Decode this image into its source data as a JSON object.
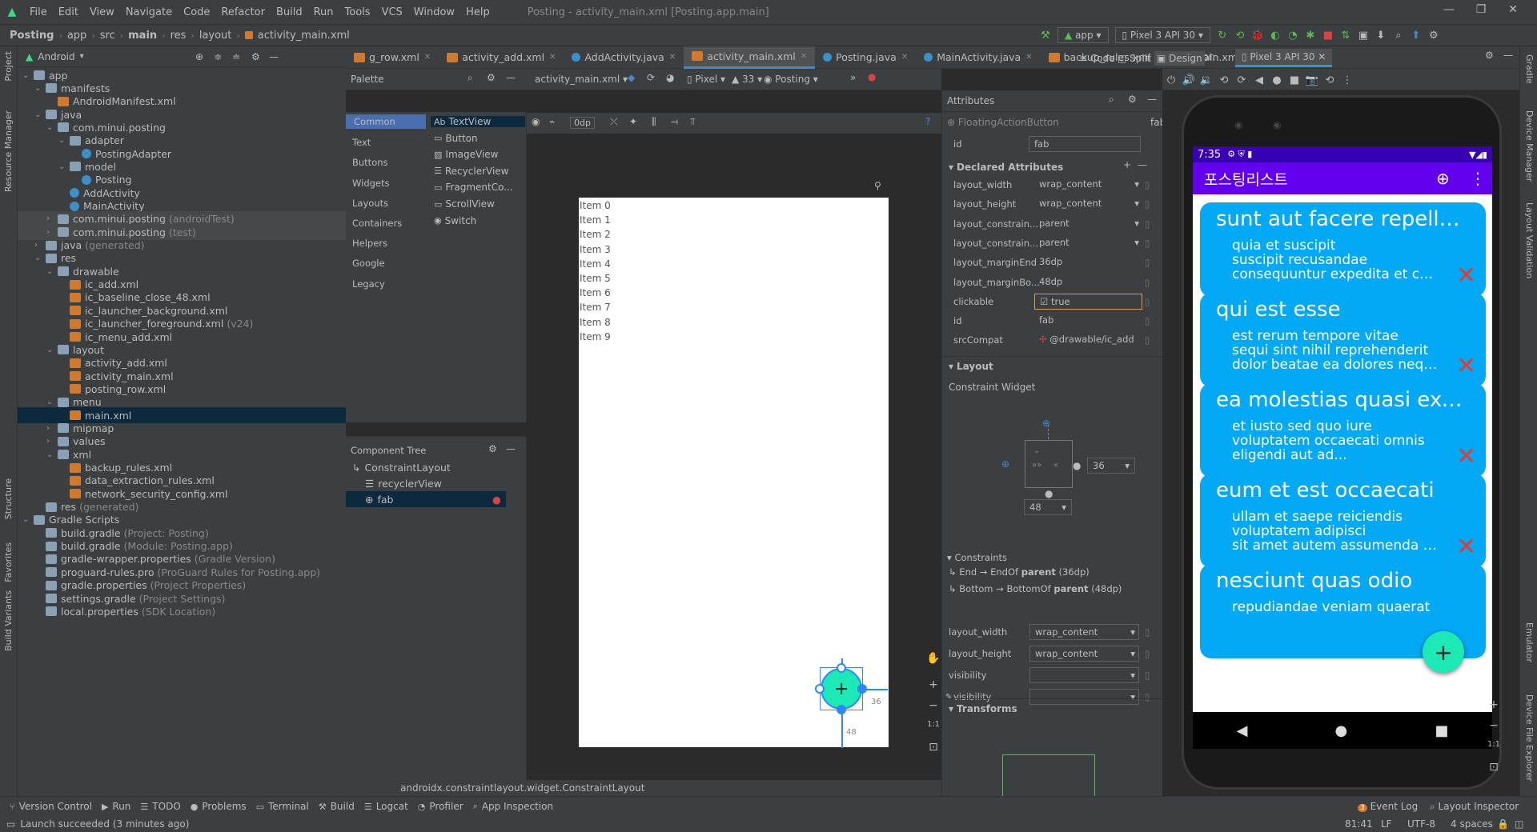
{
  "menubar": {
    "items": [
      "File",
      "Edit",
      "View",
      "Navigate",
      "Code",
      "Refactor",
      "Build",
      "Run",
      "Tools",
      "VCS",
      "Window",
      "Help"
    ],
    "window_title": "Posting - activity_main.xml [Posting.app.main]"
  },
  "breadcrumb": [
    "Posting",
    "app",
    "src",
    "main",
    "res",
    "layout",
    "activity_main.xml"
  ],
  "toolbar": {
    "run_config": "app",
    "device": "Pixel 3 API 30"
  },
  "project_panel": {
    "view_mode": "Android",
    "tree": [
      {
        "label": "app",
        "indent": 0,
        "icon": "folder",
        "arrow": "down"
      },
      {
        "label": "manifests",
        "indent": 1,
        "icon": "folder",
        "arrow": "down"
      },
      {
        "label": "AndroidManifest.xml",
        "indent": 2,
        "icon": "xml"
      },
      {
        "label": "java",
        "indent": 1,
        "icon": "folder",
        "arrow": "down"
      },
      {
        "label": "com.minui.posting",
        "indent": 2,
        "icon": "folder",
        "arrow": "down"
      },
      {
        "label": "adapter",
        "indent": 3,
        "icon": "folder",
        "arrow": "down"
      },
      {
        "label": "PostingAdapter",
        "indent": 4,
        "icon": "java"
      },
      {
        "label": "model",
        "indent": 3,
        "icon": "folder",
        "arrow": "down"
      },
      {
        "label": "Posting",
        "indent": 4,
        "icon": "java"
      },
      {
        "label": "AddActivity",
        "indent": 3,
        "icon": "java"
      },
      {
        "label": "MainActivity",
        "indent": 3,
        "icon": "java"
      },
      {
        "label": "com.minui.posting",
        "indent": 2,
        "icon": "folder",
        "arrow": "right",
        "suffix": "(androidTest)",
        "hl": true
      },
      {
        "label": "com.minui.posting",
        "indent": 2,
        "icon": "folder",
        "arrow": "right",
        "suffix": "(test)",
        "hl": true
      },
      {
        "label": "java",
        "indent": 1,
        "icon": "folder",
        "arrow": "right",
        "suffix": "(generated)"
      },
      {
        "label": "res",
        "indent": 1,
        "icon": "folder",
        "arrow": "down"
      },
      {
        "label": "drawable",
        "indent": 2,
        "icon": "folder",
        "arrow": "down"
      },
      {
        "label": "ic_add.xml",
        "indent": 3,
        "icon": "xml"
      },
      {
        "label": "ic_baseline_close_48.xml",
        "indent": 3,
        "icon": "xml"
      },
      {
        "label": "ic_launcher_background.xml",
        "indent": 3,
        "icon": "xml"
      },
      {
        "label": "ic_launcher_foreground.xml",
        "indent": 3,
        "icon": "xml",
        "suffix": "(v24)"
      },
      {
        "label": "ic_menu_add.xml",
        "indent": 3,
        "icon": "xml"
      },
      {
        "label": "layout",
        "indent": 2,
        "icon": "folder",
        "arrow": "down"
      },
      {
        "label": "activity_add.xml",
        "indent": 3,
        "icon": "xml"
      },
      {
        "label": "activity_main.xml",
        "indent": 3,
        "icon": "xml"
      },
      {
        "label": "posting_row.xml",
        "indent": 3,
        "icon": "xml"
      },
      {
        "label": "menu",
        "indent": 2,
        "icon": "folder",
        "arrow": "down"
      },
      {
        "label": "main.xml",
        "indent": 3,
        "icon": "xml",
        "sel": true
      },
      {
        "label": "mipmap",
        "indent": 2,
        "icon": "folder",
        "arrow": "right"
      },
      {
        "label": "values",
        "indent": 2,
        "icon": "folder",
        "arrow": "right"
      },
      {
        "label": "xml",
        "indent": 2,
        "icon": "folder",
        "arrow": "down"
      },
      {
        "label": "backup_rules.xml",
        "indent": 3,
        "icon": "xml"
      },
      {
        "label": "data_extraction_rules.xml",
        "indent": 3,
        "icon": "xml"
      },
      {
        "label": "network_security_config.xml",
        "indent": 3,
        "icon": "xml"
      },
      {
        "label": "res",
        "indent": 1,
        "icon": "folder",
        "suffix": "(generated)"
      },
      {
        "label": "Gradle Scripts",
        "indent": 0,
        "icon": "gradle",
        "arrow": "down"
      },
      {
        "label": "build.gradle",
        "indent": 1,
        "icon": "gradle",
        "suffix": "(Project: Posting)"
      },
      {
        "label": "build.gradle",
        "indent": 1,
        "icon": "gradle",
        "suffix": "(Module: Posting.app)"
      },
      {
        "label": "gradle-wrapper.properties",
        "indent": 1,
        "icon": "gradle",
        "suffix": "(Gradle Version)"
      },
      {
        "label": "proguard-rules.pro",
        "indent": 1,
        "icon": "gradle",
        "suffix": "(ProGuard Rules for Posting.app)"
      },
      {
        "label": "gradle.properties",
        "indent": 1,
        "icon": "gradle",
        "suffix": "(Project Properties)"
      },
      {
        "label": "settings.gradle",
        "indent": 1,
        "icon": "gradle",
        "suffix": "(Project Settings)"
      },
      {
        "label": "local.properties",
        "indent": 1,
        "icon": "gradle",
        "suffix": "(SDK Location)"
      }
    ]
  },
  "left_stripe": [
    "Project",
    "Resource Manager",
    "Structure",
    "Favorites",
    "Build Variants"
  ],
  "right_stripe": [
    "Gradle",
    "Device Manager",
    "Layout Validation",
    "Emulator",
    "Device File Explorer"
  ],
  "editor_tabs": [
    {
      "label": "g_row.xml",
      "icon": "xml"
    },
    {
      "label": "activity_add.xml",
      "icon": "xml"
    },
    {
      "label": "AddActivity.java",
      "icon": "java"
    },
    {
      "label": "activity_main.xml",
      "icon": "xml",
      "active": true
    },
    {
      "label": "Posting.java",
      "icon": "java"
    },
    {
      "label": "MainActivity.java",
      "icon": "java"
    },
    {
      "label": "backup_rules.xml",
      "icon": "xml"
    },
    {
      "label": "main.xml",
      "icon": "xml"
    }
  ],
  "view_modes": {
    "code": "Code",
    "split": "Split",
    "design": "Design"
  },
  "palette": {
    "title": "Palette",
    "categories": [
      "Common",
      "Text",
      "Buttons",
      "Widgets",
      "Layouts",
      "Containers",
      "Helpers",
      "Google",
      "Legacy"
    ],
    "items": [
      "TextView",
      "Button",
      "ImageView",
      "RecyclerView",
      "FragmentCo...",
      "ScrollView",
      "Switch"
    ],
    "textview_prefix": "Ab"
  },
  "design_toolbar": {
    "file": "activity_main.xml",
    "device": "Pixel",
    "api": "33",
    "theme": "Posting",
    "margin": "0dp"
  },
  "component_tree": {
    "title": "Component Tree",
    "items": [
      {
        "label": "ConstraintLayout",
        "indent": 0
      },
      {
        "label": "recyclerView",
        "indent": 1
      },
      {
        "label": "fab",
        "indent": 1,
        "sel": true,
        "error": true
      }
    ]
  },
  "canvas": {
    "list_items": [
      "Item 0",
      "Item 1",
      "Item 2",
      "Item 3",
      "Item 4",
      "Item 5",
      "Item 6",
      "Item 7",
      "Item 8",
      "Item 9"
    ],
    "margin_end": "36",
    "margin_bottom": "48",
    "zoom_label": "1:1"
  },
  "class_path": "androidx.constraintlayout.widget.ConstraintLayout",
  "attributes": {
    "title": "Attributes",
    "widget": "FloatingActionButton",
    "widget_id": "fab",
    "id_label": "id",
    "id_value": "fab",
    "declared_title": "Declared Attributes",
    "declared": [
      {
        "k": "layout_width",
        "v": "wrap_content",
        "dd": true
      },
      {
        "k": "layout_height",
        "v": "wrap_content",
        "dd": true
      },
      {
        "k": "layout_constrain...",
        "v": "parent",
        "dd": true
      },
      {
        "k": "layout_constrain...",
        "v": "parent",
        "dd": true
      },
      {
        "k": "layout_marginEnd",
        "v": "36dp"
      },
      {
        "k": "layout_marginBo...",
        "v": "48dp"
      },
      {
        "k": "clickable",
        "v": "true",
        "checkbox": true
      },
      {
        "k": "id",
        "v": "fab"
      },
      {
        "k": "srcCompat",
        "v": "@drawable/ic_add"
      }
    ],
    "layout_title": "Layout",
    "constraint_widget": "Constraint Widget",
    "cw_end_value": "36",
    "cw_bottom_value": "48",
    "constraints_title": "Constraints",
    "constraints": [
      {
        "from": "End",
        "to": "EndOf",
        "target": "parent",
        "margin": "(36dp)"
      },
      {
        "from": "Bottom",
        "to": "BottomOf",
        "target": "parent",
        "margin": "(48dp)"
      }
    ],
    "layout_rows": [
      {
        "k": "layout_width",
        "v": "wrap_content"
      },
      {
        "k": "layout_height",
        "v": "wrap_content"
      },
      {
        "k": "visibility",
        "v": ""
      },
      {
        "k": "visibility",
        "v": "",
        "wrench": true
      }
    ],
    "transforms_title": "Transforms"
  },
  "emulator": {
    "label": "Emulator:",
    "device_tab": "Pixel 3 API 30",
    "status_time": "7:35",
    "app_title": "포스팅리스트",
    "cards": [
      {
        "title": "sunt aut facere repellat provident",
        "lines": [
          "quia et suscipit",
          "suscipit recusandae",
          "consequuntur expedita et cum reprehenderit"
        ]
      },
      {
        "title": "qui est esse",
        "lines": [
          "est rerum tempore vitae",
          "sequi sint nihil reprehenderit",
          "dolor beatae ea dolores neque fugiat"
        ]
      },
      {
        "title": "ea molestias quasi exercitationem",
        "lines": [
          "et iusto sed quo iure",
          "voluptatem occaecati omnis",
          "eligendi aut ad..."
        ]
      },
      {
        "title": "eum et est occaecati",
        "lines": [
          "ullam et saepe reiciendis",
          "voluptatem adipisci",
          "sit amet autem assumenda provident"
        ]
      },
      {
        "title": "nesciunt quas odio",
        "lines": [
          "repudiandae veniam quaerat"
        ]
      }
    ],
    "zoom_label": "1:1"
  },
  "bottom_tools": [
    "Version Control",
    "Run",
    "TODO",
    "Problems",
    "Terminal",
    "Build",
    "Logcat",
    "Profiler",
    "App Inspection"
  ],
  "bottom_right_tools": [
    "Event Log",
    "Layout Inspector"
  ],
  "event_count": "3",
  "status": {
    "message": "Launch succeeded (3 minutes ago)",
    "position": "81:41",
    "line_sep": "LF",
    "encoding": "UTF-8",
    "indent": "4 spaces"
  },
  "colors": {
    "accent": "#4a88c7",
    "fab": "#1de9b6",
    "card": "#03a9f4",
    "appbar": "#6200ee",
    "statusbar": "#3700b3",
    "delete": "#e53935"
  }
}
